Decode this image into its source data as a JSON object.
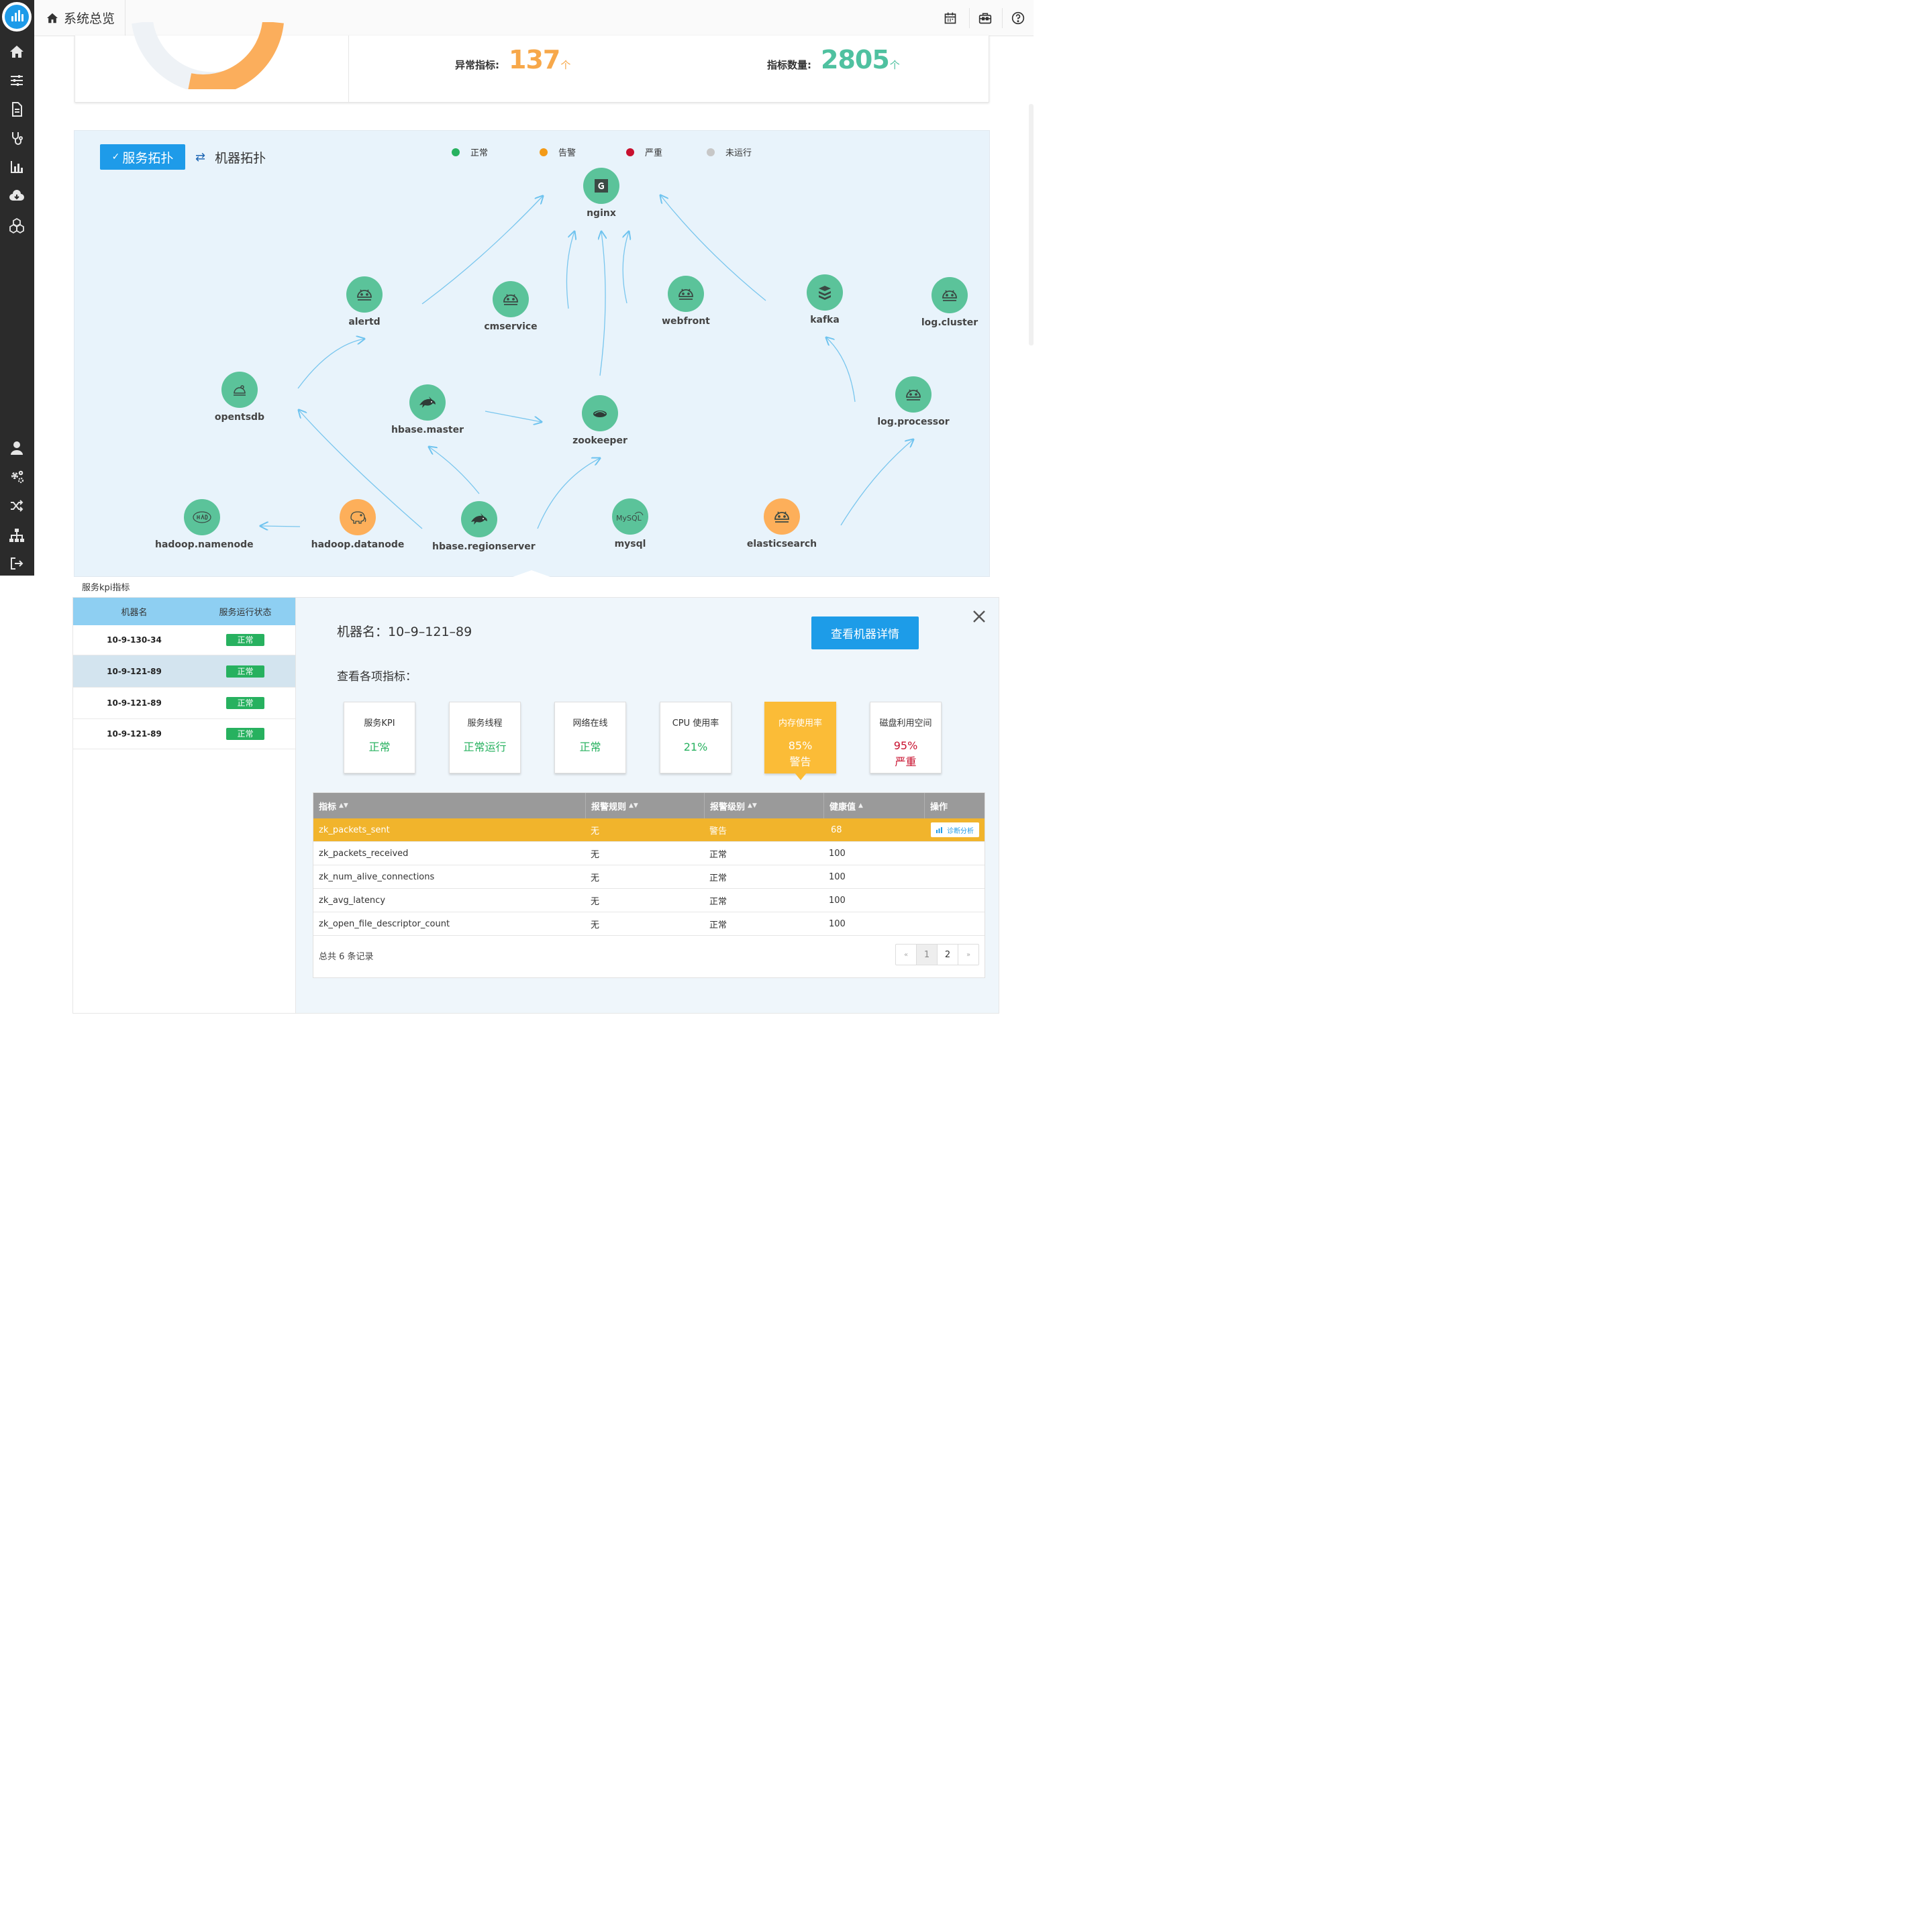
{
  "header": {
    "title": "系统总览"
  },
  "stats": {
    "abnormal_label": "异常指标:",
    "abnormal_value": "137",
    "abnormal_unit": "个",
    "count_label": "指标数量:",
    "count_value": "2805",
    "count_unit": "个",
    "colors": {
      "abnormal": "#f7a84a",
      "count": "#4fc1a0"
    }
  },
  "topology": {
    "tab_active": "服务拓扑",
    "tab_inactive": "机器拓扑",
    "legend": [
      {
        "label": "正常",
        "color": "#27b15f"
      },
      {
        "label": "告警",
        "color": "#f39a17"
      },
      {
        "label": "严重",
        "color": "#c8102e"
      },
      {
        "label": "未运行",
        "color": "#c7c7c7"
      }
    ],
    "node_colors": {
      "normal": "#5bc39a",
      "warn": "#fdaf5a"
    },
    "nodes": [
      {
        "name": "nginx",
        "icon": "nginx-icon",
        "status": "normal"
      },
      {
        "name": "alertd",
        "icon": "android-icon",
        "status": "normal"
      },
      {
        "name": "cmservice",
        "icon": "android-icon",
        "status": "normal"
      },
      {
        "name": "webfront",
        "icon": "android-icon",
        "status": "normal"
      },
      {
        "name": "kafka",
        "icon": "kafka-icon",
        "status": "normal"
      },
      {
        "name": "log.cluster",
        "icon": "android-icon",
        "status": "normal"
      },
      {
        "name": "opentsdb",
        "icon": "opentsdb-icon",
        "status": "normal"
      },
      {
        "name": "hbase.master",
        "icon": "orca-icon",
        "status": "normal"
      },
      {
        "name": "zookeeper",
        "icon": "zookeeper-icon",
        "status": "normal"
      },
      {
        "name": "log.processor",
        "icon": "android-icon",
        "status": "normal"
      },
      {
        "name": "hadoop.namenode",
        "icon": "hadoop-icon",
        "status": "normal"
      },
      {
        "name": "hadoop.datanode",
        "icon": "elephant-icon",
        "status": "warn"
      },
      {
        "name": "hbase.regionserver",
        "icon": "orca-icon",
        "status": "normal"
      },
      {
        "name": "mysql",
        "icon": "mysql-icon",
        "status": "normal"
      },
      {
        "name": "elasticsearch",
        "icon": "android-icon",
        "status": "warn"
      }
    ]
  },
  "kpi": {
    "title": "服务kpi指标",
    "list_headers": {
      "machine": "机器名",
      "status": "服务运行状态"
    },
    "machines": [
      {
        "name": "10-9-130-34",
        "status": "正常"
      },
      {
        "name": "10-9-121-89",
        "status": "正常"
      },
      {
        "name": "10-9-121-89",
        "status": "正常"
      },
      {
        "name": "10-9-121-89",
        "status": "正常"
      }
    ],
    "machine_name": "机器名：10–9–121–89",
    "detail_button": "查看机器详情",
    "metrics_title": "查看各项指标：",
    "cards": [
      {
        "title": "服务KPI",
        "value": "正常",
        "value2": ""
      },
      {
        "title": "服务线程",
        "value": "正常运行",
        "value2": ""
      },
      {
        "title": "网络在线",
        "value": "正常",
        "value2": ""
      },
      {
        "title": "CPU 使用率",
        "value": "21%",
        "value2": ""
      },
      {
        "title": "内存使用率",
        "value": "85%",
        "value2": "警告"
      },
      {
        "title": "磁盘利用空间",
        "value": "95%",
        "value2": "严重"
      }
    ],
    "table": {
      "columns": [
        "指标",
        "报警规则",
        "报警级别",
        "健康值",
        "操作"
      ],
      "rows": [
        [
          "zk_packets_sent",
          "无",
          "警告",
          "68"
        ],
        [
          "zk_packets_received",
          "无",
          "正常",
          "100"
        ],
        [
          "zk_num_alive_connections",
          "无",
          "正常",
          "100"
        ],
        [
          "zk_avg_latency",
          "无",
          "正常",
          "100"
        ],
        [
          "zk_open_file_descriptor_count",
          "无",
          "正常",
          "100"
        ]
      ],
      "action_label": "诊断分析",
      "total": "总共 6 条记录",
      "pager": {
        "prev": "«",
        "pages": [
          "1",
          "2"
        ],
        "next": "»"
      }
    }
  }
}
